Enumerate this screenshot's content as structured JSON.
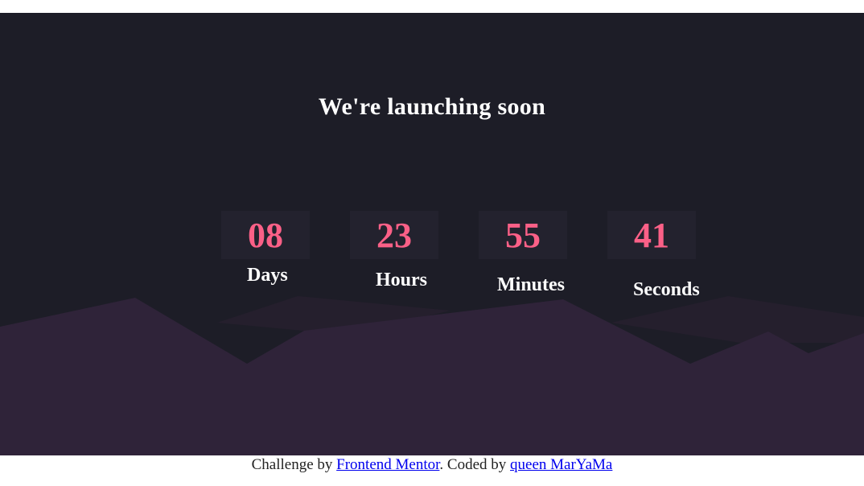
{
  "heading": "We're launching soon",
  "countdown": [
    {
      "value": "08",
      "label": "Days"
    },
    {
      "value": "23",
      "label": "Hours"
    },
    {
      "value": "55",
      "label": "Minutes"
    },
    {
      "value": "41",
      "label": "Seconds"
    }
  ],
  "footer": {
    "prefix": "Challenge by ",
    "link1": "Frontend Mentor",
    "middle": ". Coded by ",
    "link2": "queen MarYaMa"
  },
  "colors": {
    "background": "#1d1d27",
    "card": "#23222e",
    "digits": "#fb6087",
    "hills": "#2f2339"
  }
}
